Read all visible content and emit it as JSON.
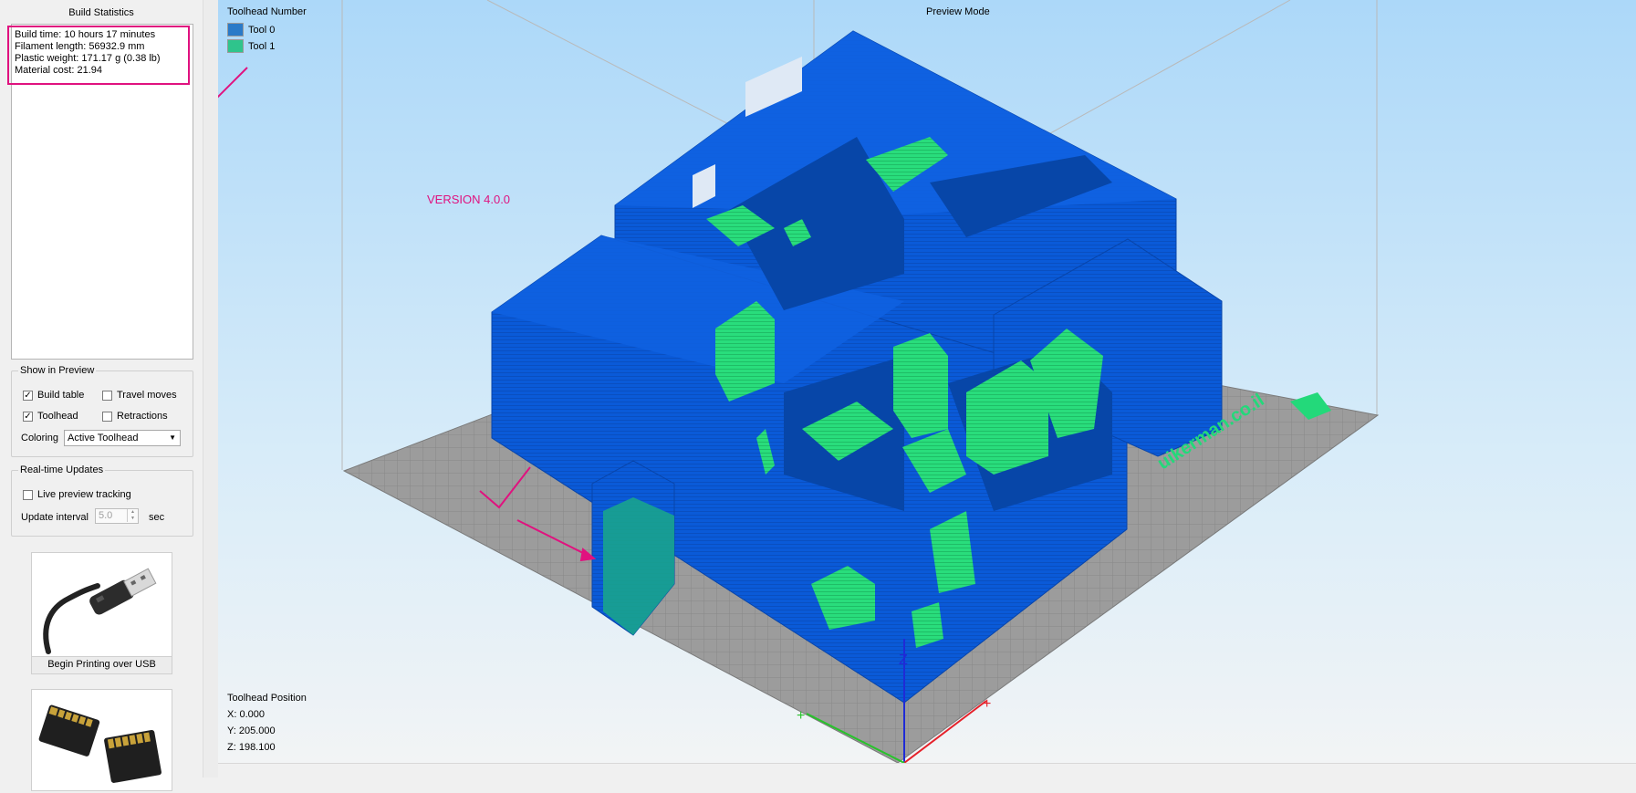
{
  "left_panel": {
    "build_statistics": {
      "title": "Build Statistics",
      "build_time": "Build time: 10 hours 17 minutes",
      "filament_length": "Filament length: 56932.9 mm",
      "plastic_weight": "Plastic weight: 171.17 g (0.38 lb)",
      "material_cost": "Material cost: 21.94"
    },
    "show_in_preview": {
      "title": "Show in Preview",
      "build_table": {
        "label": "Build table",
        "checked": true
      },
      "travel_moves": {
        "label": "Travel moves",
        "checked": false
      },
      "toolhead": {
        "label": "Toolhead",
        "checked": true
      },
      "retractions": {
        "label": "Retractions",
        "checked": false
      },
      "coloring_label": "Coloring",
      "coloring_value": "Active Toolhead"
    },
    "realtime_updates": {
      "title": "Real-time Updates",
      "live_preview": {
        "label": "Live preview tracking",
        "checked": false
      },
      "update_interval_label": "Update interval",
      "update_interval_value": "5.0",
      "update_interval_unit": "sec"
    },
    "usb_card": {
      "label": "Begin Printing over USB"
    }
  },
  "viewport": {
    "preview_mode": "Preview Mode",
    "legend": {
      "title": "Toolhead Number",
      "items": [
        {
          "label": "Tool 0",
          "color": "#2a7ac8"
        },
        {
          "label": "Tool 1",
          "color": "#2fc48c"
        }
      ]
    },
    "version_label": "VERSION 4.0.0",
    "toolhead_position": {
      "title": "Toolhead Position",
      "x": "X: 0.000",
      "y": "Y: 205.000",
      "z": "Z: 198.100"
    },
    "model_text": "uikerman.co.il"
  },
  "colors": {
    "model_blue": "#0a5ad8",
    "model_green": "#26e07a",
    "annotation": "#e0127f",
    "bed": "#9a9a9a"
  }
}
